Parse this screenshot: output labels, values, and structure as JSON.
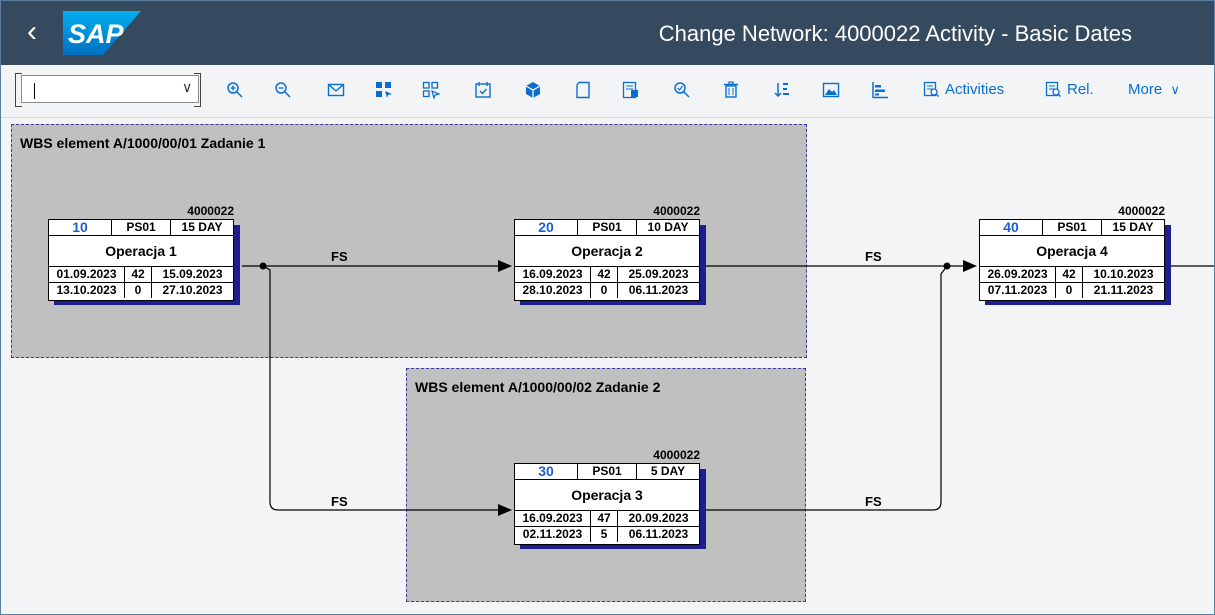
{
  "header": {
    "title": "Change Network: 4000022 Activity - Basic Dates",
    "logo_text": "SAP",
    "back_icon": "chevron-left-icon"
  },
  "toolbar": {
    "combo_value": "",
    "icons": [
      "zoom-in-icon",
      "zoom-out-icon",
      "envelope-icon",
      "grid-select-icon",
      "grid-icon",
      "calendar-check-icon",
      "box-icon",
      "page-icon",
      "document-detail-icon",
      "search-icon",
      "trash-icon",
      "sort-icon",
      "image-icon",
      "bar-chart-icon"
    ],
    "activities_label": "Activities",
    "rel_label": "Rel.",
    "more_label": "More",
    "accent": "#0a6ed1"
  },
  "network": {
    "wbs": [
      {
        "label": "WBS element A/1000/00/01 Zadanie 1"
      },
      {
        "label": "WBS element A/1000/00/02 Zadanie 2"
      }
    ],
    "nodes": [
      {
        "network": "4000022",
        "number": "10",
        "system": "PS01",
        "duration": "15 DAY",
        "desc": "Operacja 1",
        "es": "01.09.2023",
        "slack1": "42",
        "ef": "15.09.2023",
        "ls": "13.10.2023",
        "slack2": "0",
        "lf": "27.10.2023"
      },
      {
        "network": "4000022",
        "number": "20",
        "system": "PS01",
        "duration": "10 DAY",
        "desc": "Operacja 2",
        "es": "16.09.2023",
        "slack1": "42",
        "ef": "25.09.2023",
        "ls": "28.10.2023",
        "slack2": "0",
        "lf": "06.11.2023"
      },
      {
        "network": "4000022",
        "number": "30",
        "system": "PS01",
        "duration": "5 DAY",
        "desc": "Operacja 3",
        "es": "16.09.2023",
        "slack1": "47",
        "ef": "20.09.2023",
        "ls": "02.11.2023",
        "slack2": "5",
        "lf": "06.11.2023"
      },
      {
        "network": "4000022",
        "number": "40",
        "system": "PS01",
        "duration": "15 DAY",
        "desc": "Operacja 4",
        "es": "26.09.2023",
        "slack1": "42",
        "ef": "10.10.2023",
        "ls": "07.11.2023",
        "slack2": "0",
        "lf": "21.11.2023"
      }
    ],
    "relations": [
      {
        "type": "FS"
      },
      {
        "type": "FS"
      },
      {
        "type": "FS"
      },
      {
        "type": "FS"
      }
    ],
    "colors": {
      "wbs_fill": "#c0c0c0",
      "node_shadow": "#1e1e8c",
      "activity_number": "#1b5fd1",
      "header_bar": "#354a5f"
    }
  }
}
